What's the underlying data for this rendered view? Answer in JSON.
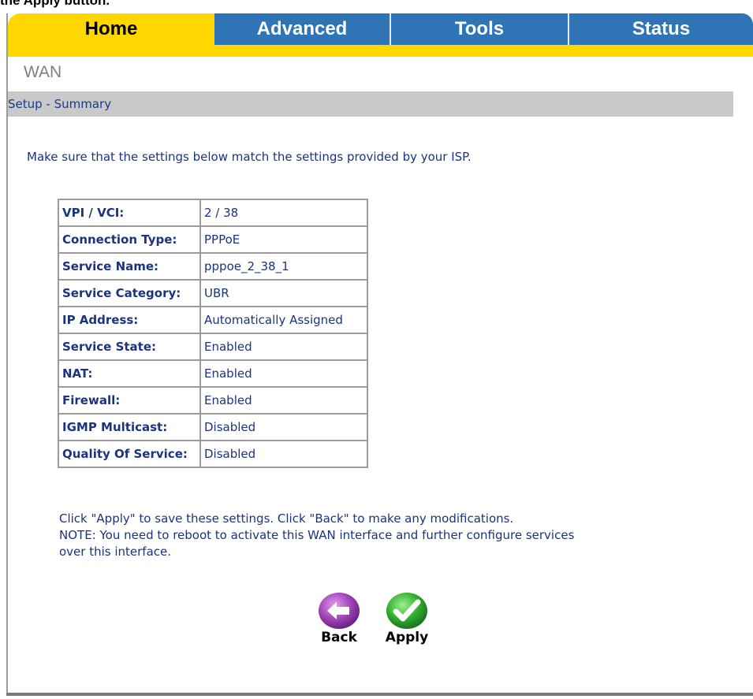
{
  "caption": "the Apply button.",
  "tabs": [
    {
      "label": "Home",
      "active": true
    },
    {
      "label": "Advanced",
      "active": false
    },
    {
      "label": "Tools",
      "active": false
    },
    {
      "label": "Status",
      "active": false
    }
  ],
  "section_title": "WAN",
  "subheader": "Setup - Summary",
  "intro": "Make sure that the settings below match the settings provided by your ISP.",
  "summary": {
    "rows": [
      {
        "label": "VPI / VCI:",
        "value": "2 / 38"
      },
      {
        "label": "Connection Type:",
        "value": "PPPoE"
      },
      {
        "label": "Service Name:",
        "value": "pppoe_2_38_1"
      },
      {
        "label": "Service Category:",
        "value": "UBR"
      },
      {
        "label": "IP Address:",
        "value": "Automatically Assigned"
      },
      {
        "label": "Service State:",
        "value": "Enabled"
      },
      {
        "label": "NAT:",
        "value": "Enabled"
      },
      {
        "label": "Firewall:",
        "value": "Enabled"
      },
      {
        "label": "IGMP Multicast:",
        "value": "Disabled"
      },
      {
        "label": "Quality Of Service:",
        "value": "Disabled"
      }
    ]
  },
  "notes": {
    "line1": "Click \"Apply\" to save these settings. Click \"Back\" to make any modifications.",
    "line2": "NOTE: You need to reboot to activate this WAN interface and further configure services",
    "line3": "over this interface."
  },
  "buttons": {
    "back_label": "Back",
    "apply_label": "Apply",
    "back_icon": "back-arrow-icon",
    "apply_icon": "checkmark-icon"
  },
  "colors": {
    "tab_active": "#ffd700",
    "tab_inactive": "#2f74b4",
    "text_blue": "#1c3380",
    "back_purple": "#a044b8",
    "apply_green": "#2fae2f"
  }
}
